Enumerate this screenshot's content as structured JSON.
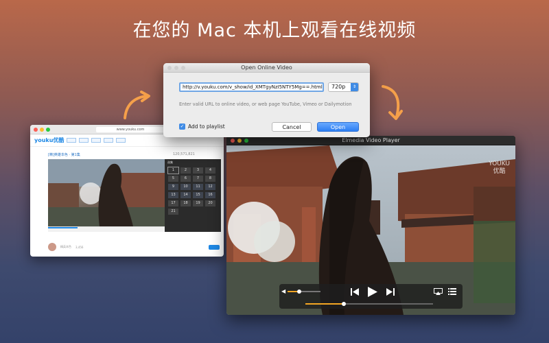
{
  "headline": "在您的 Mac 本机上观看在线视频",
  "browser": {
    "url": "www.youku.com",
    "logo": "youku优酷",
    "crumb": "[精]英雄本色 · 第1集",
    "count": "120,571,821",
    "side_label": "选集",
    "episodes": [
      "1",
      "2",
      "3",
      "4",
      "5",
      "6",
      "7",
      "8",
      "9",
      "10",
      "11",
      "12",
      "13",
      "14",
      "15",
      "16",
      "17",
      "18",
      "19",
      "20",
      "21"
    ],
    "author": "精英本色",
    "follow_count": "3,456"
  },
  "dialog": {
    "title": "Open Online Video",
    "url_value": "http://v.youku.com/v_show/id_XMTgyNzI5NTY5Mg==.html",
    "quality": "720p",
    "hint": "Enter valid URL to online video, or web page YouTube, Vimeo or Dailymotion",
    "add_to_playlist": "Add to playlist",
    "cancel": "Cancel",
    "open": "Open"
  },
  "player": {
    "title": "Elmedia Video Player",
    "watermark_line1": "YOUKU",
    "watermark_line2": "优酷",
    "volume_level": 0.35,
    "seek_progress": 0.3
  },
  "colors": {
    "accent": "#3f8be5",
    "progress": "#f5a623"
  },
  "icons": [
    "volume-icon",
    "rewind-icon",
    "play-icon",
    "fast-forward-icon",
    "airplay-icon",
    "playlist-icon"
  ]
}
